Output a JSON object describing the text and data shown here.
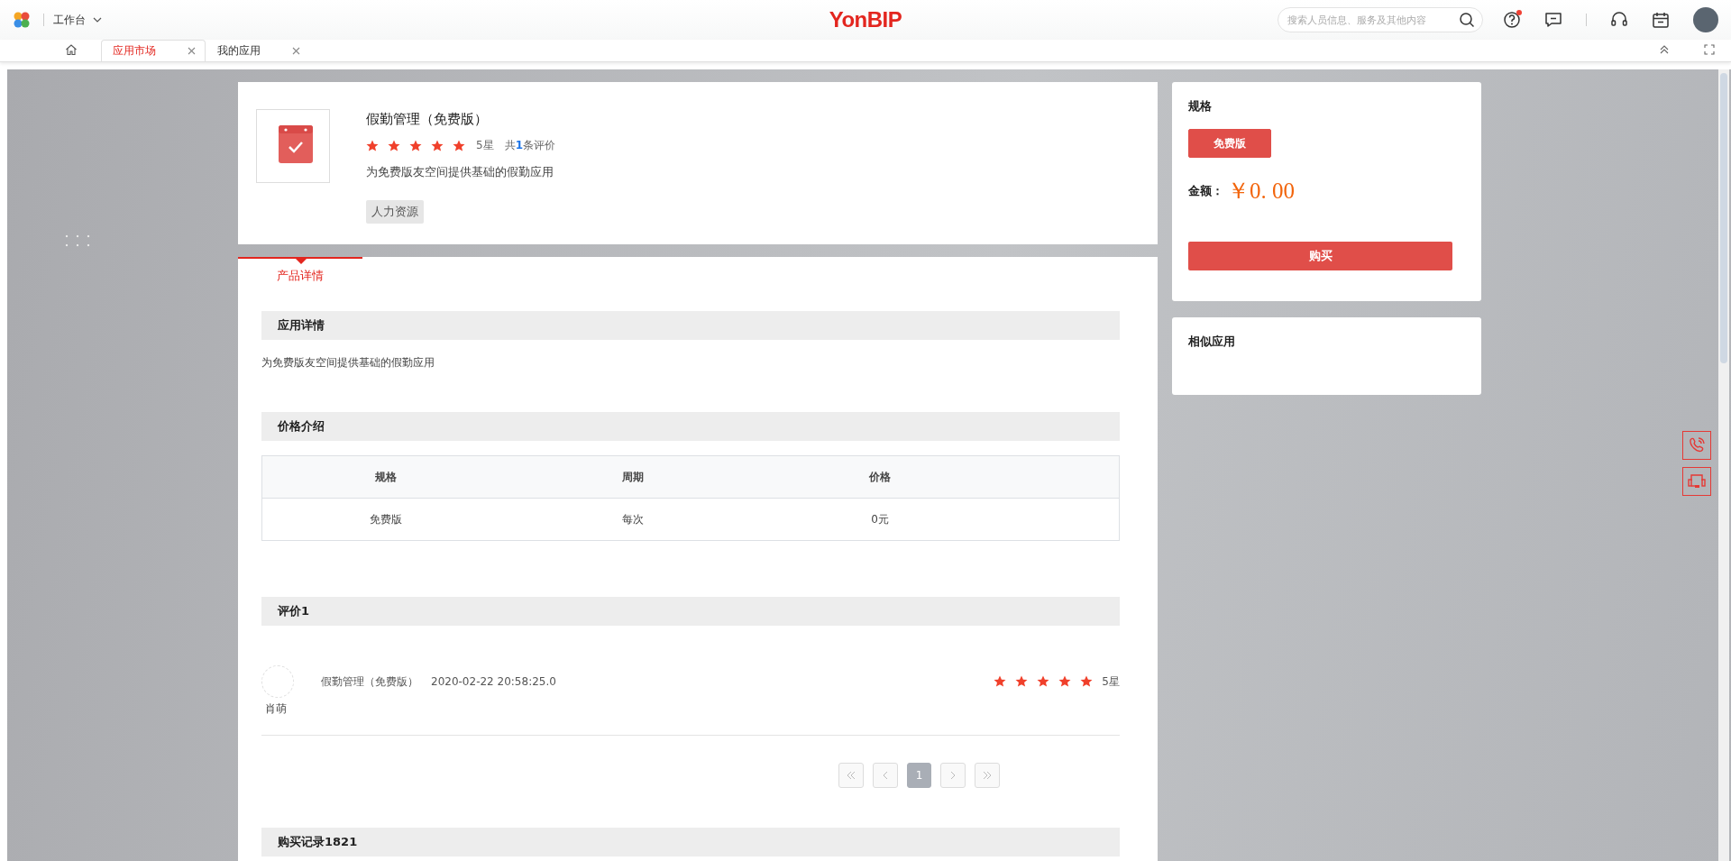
{
  "topbar": {
    "workspace": "工作台",
    "logo": "YonBIP",
    "search": {
      "placeholder": "搜索人员信息、服务及其他内容"
    },
    "help_has_notice": true
  },
  "tabs": [
    {
      "label": "应用市场",
      "selected": true
    },
    {
      "label": "我的应用",
      "selected": false
    }
  ],
  "product": {
    "name": "假勤管理（免费版）",
    "stars": 5,
    "rating": "5星",
    "review_count": "共**1**条评价",
    "description": "为免费版友空间提供基础的假勤应用",
    "tag": "人力资源"
  },
  "detail_tabs": [
    {
      "label": "产品详情",
      "selected": true
    }
  ],
  "sections": [
    {
      "kind": "text",
      "title": "应用详情",
      "text": "为免费版友空间提供基础的假勤应用"
    },
    {
      "kind": "table",
      "title": "价格介绍",
      "columns": [
        "规格",
        "周期",
        "价格"
      ],
      "rows": [
        [
          "免费版",
          "每次",
          "0元"
        ]
      ]
    },
    {
      "kind": "reviews",
      "title": "评价1",
      "reviews": [
        {
          "product": "假勤管理（免费版）",
          "time": "2020-02-22 20:58:25.0",
          "user": "肖萌",
          "stars": 5,
          "rating": "5星"
        }
      ],
      "pages": [
        {
          "label": "1",
          "selected": true
        }
      ]
    },
    {
      "kind": "heading",
      "title": "购买记录1821"
    }
  ],
  "purchase": {
    "title": "规格",
    "specs": [
      {
        "label": "免费版",
        "selected": true
      }
    ],
    "amount_label": "金额：",
    "amount": "￥0. 00",
    "buy": "购买"
  },
  "similar": {
    "title": "相似应用"
  }
}
